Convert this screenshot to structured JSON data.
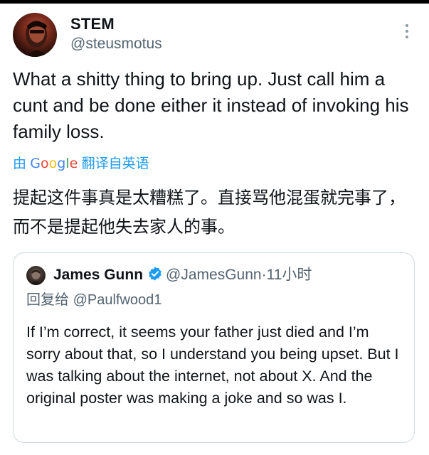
{
  "tweet": {
    "author": {
      "display_name": "STEM",
      "handle": "@steusmotus",
      "avatar": "avatar-photo"
    },
    "text": "What a shitty thing to bring up. Just call him a cunt and be done either it instead of invoking his family loss.",
    "translation": {
      "prefix": "由",
      "provider": "Google",
      "label": "翻译自英语",
      "text": "提起这件事真是太糟糕了。直接骂他混蛋就完事了，而不是提起他失去家人的事。"
    },
    "more_icon": "more-vertical-icon"
  },
  "quote": {
    "author": {
      "display_name": "James Gunn",
      "handle": "@JamesGunn",
      "separator": "·",
      "time": "11小时",
      "verified_icon": "verified-badge-icon"
    },
    "reply_to": {
      "prefix": "回复给",
      "handle": "@Paulfwood1"
    },
    "text": "If I’m correct, it seems your father just died and I’m sorry about that, so I understand you being upset. But I was talking about the internet, not about X. And the original poster was making a joke and so was I."
  },
  "colors": {
    "text": "#0f1419",
    "secondary": "#536471",
    "accent": "#1d9bf0",
    "border": "#cfd9de",
    "google_blue": "#4285F4",
    "google_red": "#EA4335",
    "google_yellow": "#FBBC05",
    "google_green": "#34A853"
  }
}
